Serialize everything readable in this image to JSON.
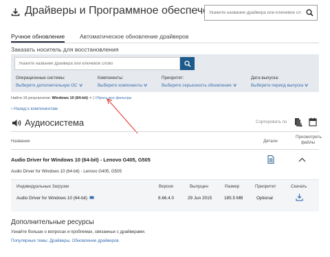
{
  "header": {
    "title": "Драйверы и Программное обеспечение",
    "search_placeholder": "Укажите название драйвера или ключевое сл"
  },
  "tabs": [
    {
      "label": "Ручное обновление",
      "active": true
    },
    {
      "label": "Автоматическое обновление драйверов",
      "active": false
    }
  ],
  "order_media_label": "Заказать носитель для восстановления",
  "filter_panel": {
    "search_placeholder": "Укажите название драйвера или ключевое слово",
    "filters": [
      {
        "label": "Операционные системы:",
        "value": "Выберите дополнительную ОС"
      },
      {
        "label": "Компоненты:",
        "value": "Выберите компоненты"
      },
      {
        "label": "Приоритет:",
        "value": "Выберите серьезность обновления"
      },
      {
        "label": "Дата выпуска:",
        "value": "Выберите период выпуска"
      }
    ]
  },
  "results": {
    "found_text": "Найти 16 результатов:",
    "selected_os": "Windows 10 (64-bit)",
    "remove_symbol": "×",
    "separator": "|",
    "clear_all": "Убрать все фильтры"
  },
  "back_link": "Назад к компонентам",
  "section": {
    "title": "Аудиосистема",
    "sort_label": "Сортировать по"
  },
  "table_header": {
    "name": "Название",
    "details": "Детали",
    "view_files": "Просмотреть файлы"
  },
  "driver": {
    "title": "Audio Driver for Windows 10 (64-bit) - Lenovo G405, G505",
    "subtitle": "Audio Driver for Windows 10 (64-bit) - Lenovo G405, G505"
  },
  "downloads": {
    "headers": {
      "individual": "Индивидуальные Загрузки",
      "version": "Версия",
      "released": "Выпущен",
      "size": "Размер",
      "priority": "Приоритет",
      "download": "Скачать"
    },
    "row": {
      "file": "Audio Driver for Windows 10 (64-bit)",
      "version": "8.66.4.0",
      "released": "29 Jun 2015",
      "size": "185.5 MB",
      "priority": "Optional"
    }
  },
  "resources": {
    "title": "Дополнительные ресурсы",
    "text": "Узнайте больше о вопросах и проблемах, связанных с драйверами.",
    "links_label": "Популярные темы:",
    "links": "Драйверы, Обновление драйверов"
  },
  "colors": {
    "accent": "#1c5a8c",
    "link": "#3a6fb0",
    "panel": "#e6e9ed",
    "annotation": "#e0453a"
  },
  "icons": [
    "download-icon",
    "search-icon",
    "speaker-icon",
    "sort-icon",
    "calendar-icon",
    "document-icon",
    "chevron-up-icon",
    "monitor-icon"
  ]
}
